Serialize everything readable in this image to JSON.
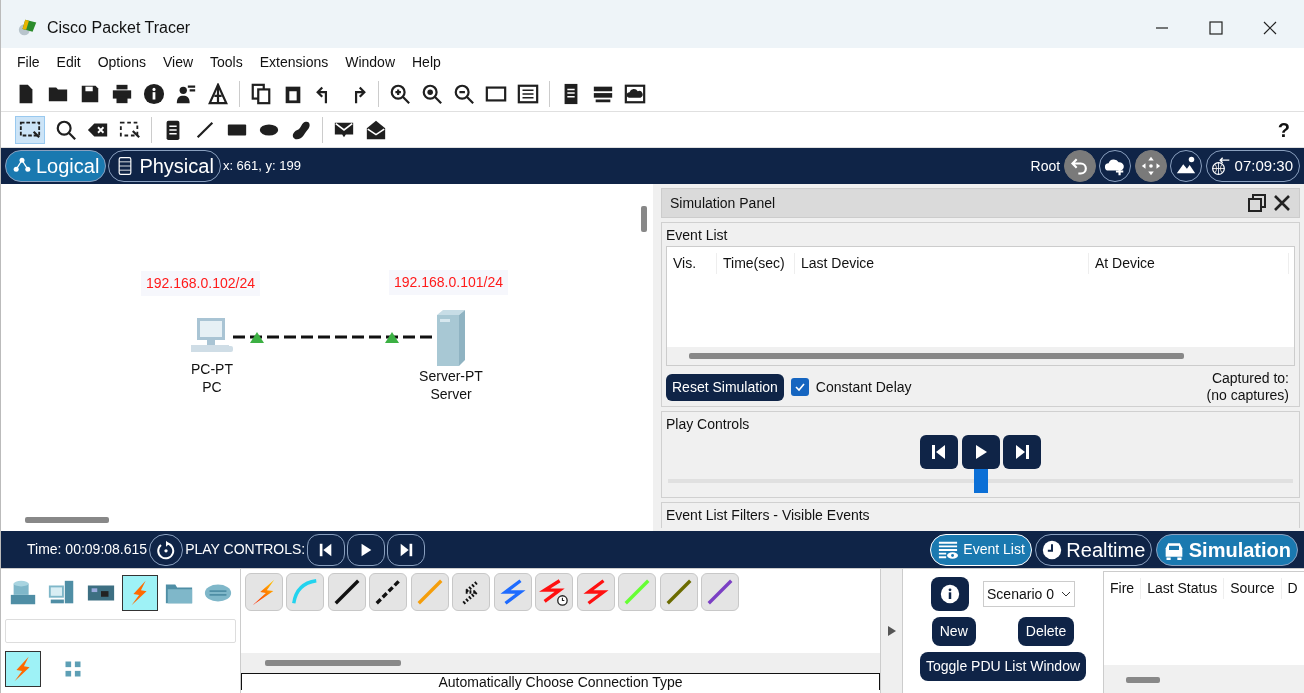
{
  "window": {
    "title": "Cisco Packet Tracer"
  },
  "menu": [
    "File",
    "Edit",
    "Options",
    "View",
    "Tools",
    "Extensions",
    "Window",
    "Help"
  ],
  "help_button": "?",
  "workspace_tabs": [
    {
      "label": "Logical",
      "selected": true
    },
    {
      "label": "Physical",
      "selected": false
    }
  ],
  "coordinates": "x: 661, y: 199",
  "location": "Root",
  "clock": "07:09:30",
  "canvas": {
    "devices": [
      {
        "kind": "pc",
        "ip": "192.168.0.102/24",
        "model": "PC-PT",
        "name": "PC"
      },
      {
        "kind": "server",
        "ip": "192.168.0.101/24",
        "model": "Server-PT",
        "name": "Server"
      }
    ]
  },
  "simulation_panel": {
    "title": "Simulation Panel",
    "event_list": {
      "title": "Event List",
      "columns": [
        "Vis.",
        "Time(sec)",
        "Last Device",
        "At Device"
      ]
    },
    "reset_button": "Reset Simulation",
    "constant_delay": {
      "label": "Constant Delay",
      "checked": true
    },
    "captured_label": "Captured to:",
    "captured_value": "(no captures)",
    "play_controls": {
      "title": "Play Controls",
      "level": 0.5
    },
    "filters_title": "Event List Filters - Visible Events"
  },
  "bottom_bar": {
    "time": "Time: 00:09:08.615",
    "play_label": "PLAY CONTROLS:",
    "event_list_button": {
      "label": "Event List",
      "on": true
    },
    "modes": [
      {
        "label": "Realtime",
        "selected": false
      },
      {
        "label": "Simulation",
        "selected": true
      }
    ]
  },
  "device_categories": [
    {
      "kind": "network",
      "selected": false
    },
    {
      "kind": "end",
      "selected": false
    },
    {
      "kind": "component",
      "selected": false
    },
    {
      "kind": "connection",
      "selected": true
    },
    {
      "kind": "misc",
      "selected": false
    },
    {
      "kind": "multiuser",
      "selected": false
    }
  ],
  "device_subtypes": [
    {
      "kind": "connection",
      "selected": true
    },
    {
      "kind": "grid",
      "selected": false
    }
  ],
  "connections": [
    {
      "kind": "lightning"
    },
    {
      "kind": "curve",
      "color": "#22d3ee"
    },
    {
      "kind": "line",
      "color": "#111111"
    },
    {
      "kind": "dashed",
      "color": "#111111"
    },
    {
      "kind": "line",
      "color": "#f59e0b"
    },
    {
      "kind": "dotted-zigzag",
      "color": "#111111"
    },
    {
      "kind": "zigzag",
      "color": "#1e6bff"
    },
    {
      "kind": "zigzag-clock",
      "color": "#ff1010"
    },
    {
      "kind": "zigzag",
      "color": "#ff1010"
    },
    {
      "kind": "line",
      "color": "#66ff33"
    },
    {
      "kind": "line",
      "color": "#6b6b00"
    },
    {
      "kind": "line",
      "color": "#7b3fc4"
    }
  ],
  "connection_caption": "Automatically Choose Connection Type",
  "scenario": {
    "select": "Scenario 0",
    "buttons": [
      "New",
      "Delete"
    ],
    "toggle_button": "Toggle PDU List Window"
  },
  "pdu_table": {
    "columns": [
      "Fire",
      "Last Status",
      "Source",
      "D"
    ]
  }
}
